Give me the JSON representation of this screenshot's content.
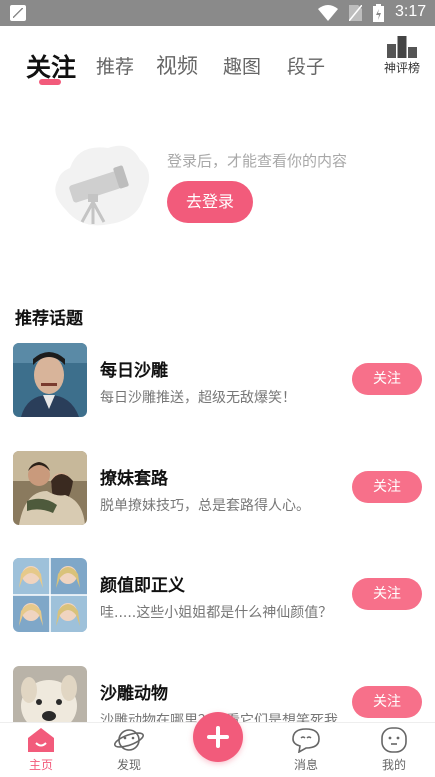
{
  "status_bar": {
    "time": "3:17"
  },
  "top_tabs": [
    {
      "label": "关注",
      "active": true
    },
    {
      "label": "推荐",
      "active": false
    },
    {
      "label": "视频",
      "active": false
    },
    {
      "label": "趣图",
      "active": false
    },
    {
      "label": "段子",
      "active": false
    }
  ],
  "rank": {
    "label": "神评榜",
    "icon": "podium-icon"
  },
  "empty_state": {
    "message": "登录后，才能查看你的内容",
    "login_label": "去登录",
    "illustration": "telescope-icon"
  },
  "section_title": "推荐话题",
  "topics": [
    {
      "title": "每日沙雕",
      "desc": "每日沙雕推送，超级无敌爆笑！",
      "follow_label": "关注"
    },
    {
      "title": "撩妹套路",
      "desc": "脱单撩妹技巧，总是套路得人心。",
      "follow_label": "关注"
    },
    {
      "title": "颜值即正义",
      "desc": "哇.....这些小姐姐都是什么神仙颜值？",
      "follow_label": "关注"
    },
    {
      "title": "沙雕动物",
      "desc": "沙雕动物在哪里？我看它们是想笑死我！",
      "follow_label": "关注"
    }
  ],
  "bottom_nav": [
    {
      "label": "主页",
      "icon": "home-icon",
      "active": true
    },
    {
      "label": "发现",
      "icon": "planet-icon",
      "active": false
    },
    {
      "label": "消息",
      "icon": "message-icon",
      "active": false
    },
    {
      "label": "我的",
      "icon": "profile-icon",
      "active": false
    }
  ],
  "colors": {
    "accent": "#f25b7b",
    "follow_button": "#f7708a"
  }
}
